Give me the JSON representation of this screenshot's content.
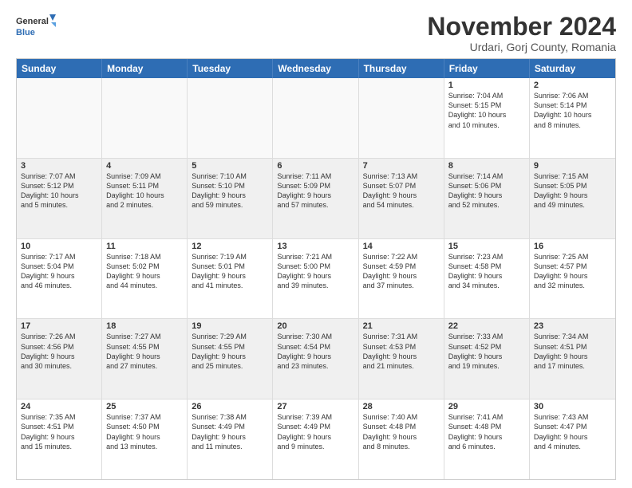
{
  "logo": {
    "line1": "General",
    "line2": "Blue"
  },
  "title": "November 2024",
  "location": "Urdari, Gorj County, Romania",
  "header_days": [
    "Sunday",
    "Monday",
    "Tuesday",
    "Wednesday",
    "Thursday",
    "Friday",
    "Saturday"
  ],
  "rows": [
    [
      {
        "day": "",
        "text": "",
        "empty": true
      },
      {
        "day": "",
        "text": "",
        "empty": true
      },
      {
        "day": "",
        "text": "",
        "empty": true
      },
      {
        "day": "",
        "text": "",
        "empty": true
      },
      {
        "day": "",
        "text": "",
        "empty": true
      },
      {
        "day": "1",
        "text": "Sunrise: 7:04 AM\nSunset: 5:15 PM\nDaylight: 10 hours\nand 10 minutes.",
        "empty": false
      },
      {
        "day": "2",
        "text": "Sunrise: 7:06 AM\nSunset: 5:14 PM\nDaylight: 10 hours\nand 8 minutes.",
        "empty": false
      }
    ],
    [
      {
        "day": "3",
        "text": "Sunrise: 7:07 AM\nSunset: 5:12 PM\nDaylight: 10 hours\nand 5 minutes.",
        "empty": false
      },
      {
        "day": "4",
        "text": "Sunrise: 7:09 AM\nSunset: 5:11 PM\nDaylight: 10 hours\nand 2 minutes.",
        "empty": false
      },
      {
        "day": "5",
        "text": "Sunrise: 7:10 AM\nSunset: 5:10 PM\nDaylight: 9 hours\nand 59 minutes.",
        "empty": false
      },
      {
        "day": "6",
        "text": "Sunrise: 7:11 AM\nSunset: 5:09 PM\nDaylight: 9 hours\nand 57 minutes.",
        "empty": false
      },
      {
        "day": "7",
        "text": "Sunrise: 7:13 AM\nSunset: 5:07 PM\nDaylight: 9 hours\nand 54 minutes.",
        "empty": false
      },
      {
        "day": "8",
        "text": "Sunrise: 7:14 AM\nSunset: 5:06 PM\nDaylight: 9 hours\nand 52 minutes.",
        "empty": false
      },
      {
        "day": "9",
        "text": "Sunrise: 7:15 AM\nSunset: 5:05 PM\nDaylight: 9 hours\nand 49 minutes.",
        "empty": false
      }
    ],
    [
      {
        "day": "10",
        "text": "Sunrise: 7:17 AM\nSunset: 5:04 PM\nDaylight: 9 hours\nand 46 minutes.",
        "empty": false
      },
      {
        "day": "11",
        "text": "Sunrise: 7:18 AM\nSunset: 5:02 PM\nDaylight: 9 hours\nand 44 minutes.",
        "empty": false
      },
      {
        "day": "12",
        "text": "Sunrise: 7:19 AM\nSunset: 5:01 PM\nDaylight: 9 hours\nand 41 minutes.",
        "empty": false
      },
      {
        "day": "13",
        "text": "Sunrise: 7:21 AM\nSunset: 5:00 PM\nDaylight: 9 hours\nand 39 minutes.",
        "empty": false
      },
      {
        "day": "14",
        "text": "Sunrise: 7:22 AM\nSunset: 4:59 PM\nDaylight: 9 hours\nand 37 minutes.",
        "empty": false
      },
      {
        "day": "15",
        "text": "Sunrise: 7:23 AM\nSunset: 4:58 PM\nDaylight: 9 hours\nand 34 minutes.",
        "empty": false
      },
      {
        "day": "16",
        "text": "Sunrise: 7:25 AM\nSunset: 4:57 PM\nDaylight: 9 hours\nand 32 minutes.",
        "empty": false
      }
    ],
    [
      {
        "day": "17",
        "text": "Sunrise: 7:26 AM\nSunset: 4:56 PM\nDaylight: 9 hours\nand 30 minutes.",
        "empty": false
      },
      {
        "day": "18",
        "text": "Sunrise: 7:27 AM\nSunset: 4:55 PM\nDaylight: 9 hours\nand 27 minutes.",
        "empty": false
      },
      {
        "day": "19",
        "text": "Sunrise: 7:29 AM\nSunset: 4:55 PM\nDaylight: 9 hours\nand 25 minutes.",
        "empty": false
      },
      {
        "day": "20",
        "text": "Sunrise: 7:30 AM\nSunset: 4:54 PM\nDaylight: 9 hours\nand 23 minutes.",
        "empty": false
      },
      {
        "day": "21",
        "text": "Sunrise: 7:31 AM\nSunset: 4:53 PM\nDaylight: 9 hours\nand 21 minutes.",
        "empty": false
      },
      {
        "day": "22",
        "text": "Sunrise: 7:33 AM\nSunset: 4:52 PM\nDaylight: 9 hours\nand 19 minutes.",
        "empty": false
      },
      {
        "day": "23",
        "text": "Sunrise: 7:34 AM\nSunset: 4:51 PM\nDaylight: 9 hours\nand 17 minutes.",
        "empty": false
      }
    ],
    [
      {
        "day": "24",
        "text": "Sunrise: 7:35 AM\nSunset: 4:51 PM\nDaylight: 9 hours\nand 15 minutes.",
        "empty": false
      },
      {
        "day": "25",
        "text": "Sunrise: 7:37 AM\nSunset: 4:50 PM\nDaylight: 9 hours\nand 13 minutes.",
        "empty": false
      },
      {
        "day": "26",
        "text": "Sunrise: 7:38 AM\nSunset: 4:49 PM\nDaylight: 9 hours\nand 11 minutes.",
        "empty": false
      },
      {
        "day": "27",
        "text": "Sunrise: 7:39 AM\nSunset: 4:49 PM\nDaylight: 9 hours\nand 9 minutes.",
        "empty": false
      },
      {
        "day": "28",
        "text": "Sunrise: 7:40 AM\nSunset: 4:48 PM\nDaylight: 9 hours\nand 8 minutes.",
        "empty": false
      },
      {
        "day": "29",
        "text": "Sunrise: 7:41 AM\nSunset: 4:48 PM\nDaylight: 9 hours\nand 6 minutes.",
        "empty": false
      },
      {
        "day": "30",
        "text": "Sunrise: 7:43 AM\nSunset: 4:47 PM\nDaylight: 9 hours\nand 4 minutes.",
        "empty": false
      }
    ]
  ]
}
